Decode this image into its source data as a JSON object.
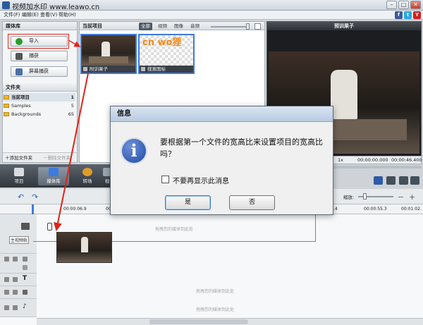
{
  "window": {
    "title": "视频加水印 www.leawo.cn",
    "min": "–",
    "max": "□",
    "close": "✕"
  },
  "menu": [
    "文件(F)",
    "编辑(E)",
    "查看(V)",
    "帮助(H)"
  ],
  "social": [
    "f",
    "t",
    "Y"
  ],
  "media_library": {
    "title": "媒体库",
    "import_label": "导入",
    "capture_label": "捕获",
    "screen_capture_label": "屏幕捕获",
    "folders_title": "文件夹",
    "folders": [
      {
        "name": "当前项目",
        "count": "1"
      },
      {
        "name": "Samples",
        "count": "5"
      },
      {
        "name": "Backgrounds",
        "count": "65"
      }
    ],
    "add_folder_label": "添加文件夹",
    "delete_folder_label": "删除文件夹"
  },
  "project_panel": {
    "title": "当前项目",
    "tabs": [
      "全部",
      "视频",
      "图像",
      "音频"
    ],
    "items": [
      {
        "label": "附训果子",
        "icon": "video-icon"
      },
      {
        "label": "搜寞图标",
        "icon": "image-icon",
        "logo_text": "cn wo狸"
      }
    ]
  },
  "preview": {
    "title": "预训果子",
    "speed": "1x",
    "time_current": "00:00:00.000",
    "time_total": "00:00:46.400"
  },
  "toolbar": {
    "project": "项目",
    "media": "媒体库",
    "transitions": "转场",
    "extra": "视"
  },
  "timeline": {
    "zoom_label": "缩放:",
    "ruler_left": [
      "00:00:06.9",
      "00"
    ],
    "ruler_right": [
      ".4",
      "00:00:55.3",
      "00:01:02."
    ],
    "video_track_label": "主视频轨",
    "drop_hint": "拖拽您的媒体到此处"
  },
  "dialog": {
    "title": "信息",
    "message": "要根据第一个文件的宽高比来设置项目的宽高比吗？",
    "checkbox_label": "不要再显示此消息",
    "checkbox_checked": false,
    "yes_label": "是",
    "no_label": "否"
  },
  "colors": {
    "accent_red": "#e0231a",
    "selection_blue": "#3d7bd8",
    "timeline_green": "#3db33d"
  }
}
